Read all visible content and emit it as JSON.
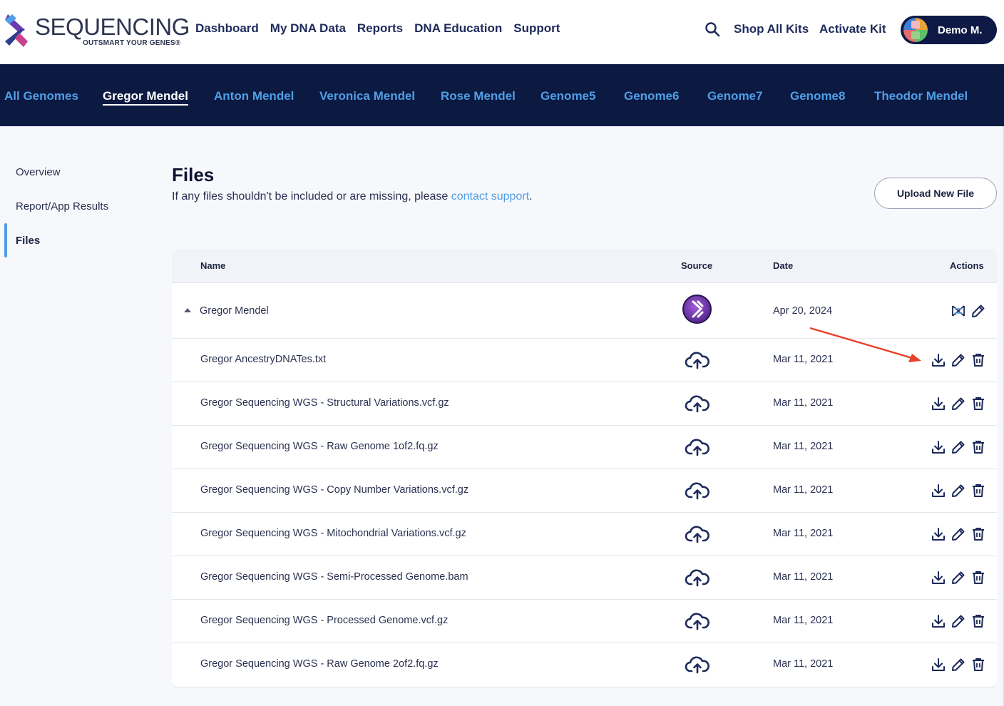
{
  "brand": {
    "name": "SEQUENCING",
    "tagline": "OUTSMART YOUR GENES®"
  },
  "nav": {
    "links": [
      "Dashboard",
      "My DNA Data",
      "Reports",
      "DNA Education",
      "Support"
    ],
    "shop": "Shop All Kits",
    "activate": "Activate Kit",
    "user": "Demo M."
  },
  "genomes": {
    "tabs": [
      "All Genomes",
      "Gregor Mendel",
      "Anton Mendel",
      "Veronica Mendel",
      "Rose Mendel",
      "Genome5",
      "Genome6",
      "Genome7",
      "Genome8",
      "Theodor Mendel"
    ],
    "active": "Gregor Mendel"
  },
  "sidebar": {
    "items": [
      "Overview",
      "Report/App Results",
      "Files"
    ],
    "active": "Files"
  },
  "page": {
    "title": "Files",
    "subtitle_prefix": "If any files shouldn't be included or are missing, please ",
    "subtitle_link": "contact support",
    "subtitle_suffix": ".",
    "upload_button": "Upload New File"
  },
  "table": {
    "headers": {
      "name": "Name",
      "source": "Source",
      "date": "Date",
      "actions": "Actions"
    },
    "group": {
      "name": "Gregor Mendel",
      "date": "Apr 20, 2024",
      "source_icon": "sequencing-avatar",
      "actions": [
        "compare-icon",
        "edit-icon"
      ]
    },
    "rows": [
      {
        "name": "Gregor AncestryDNATes.txt",
        "date": "Mar 11, 2021",
        "source_icon": "cloud-upload-icon"
      },
      {
        "name": "Gregor Sequencing WGS - Structural Variations.vcf.gz",
        "date": "Mar 11, 2021",
        "source_icon": "cloud-upload-icon"
      },
      {
        "name": "Gregor Sequencing WGS - Raw Genome 1of2.fq.gz",
        "date": "Mar 11, 2021",
        "source_icon": "cloud-upload-icon"
      },
      {
        "name": "Gregor Sequencing WGS - Copy Number Variations.vcf.gz",
        "date": "Mar 11, 2021",
        "source_icon": "cloud-upload-icon"
      },
      {
        "name": "Gregor Sequencing WGS - Mitochondrial Variations.vcf.gz",
        "date": "Mar 11, 2021",
        "source_icon": "cloud-upload-icon"
      },
      {
        "name": "Gregor Sequencing WGS - Semi-Processed Genome.bam",
        "date": "Mar 11, 2021",
        "source_icon": "cloud-upload-icon"
      },
      {
        "name": "Gregor Sequencing WGS - Processed Genome.vcf.gz",
        "date": "Mar 11, 2021",
        "source_icon": "cloud-upload-icon"
      },
      {
        "name": "Gregor Sequencing WGS - Raw Genome 2of2.fq.gz",
        "date": "Mar 11, 2021",
        "source_icon": "cloud-upload-icon"
      }
    ],
    "row_actions": [
      "download-icon",
      "edit-icon",
      "delete-icon"
    ]
  },
  "colors": {
    "navy": "#0c1941",
    "accent": "#4f9fe6",
    "annotation_arrow": "#e8412a"
  }
}
